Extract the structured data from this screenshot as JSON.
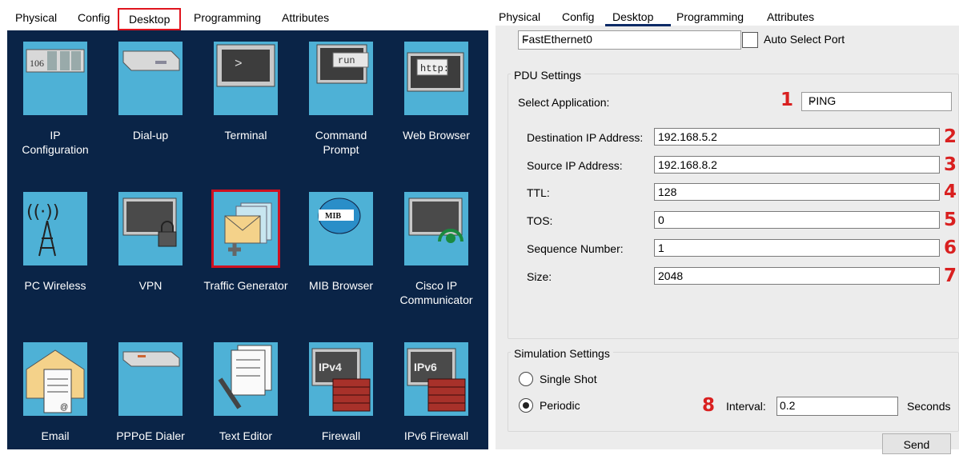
{
  "left": {
    "tabs": [
      "Physical",
      "Config",
      "Desktop",
      "Programming",
      "Attributes"
    ],
    "apps": [
      {
        "label": "IP Configuration",
        "icon": "ip-configuration-icon"
      },
      {
        "label": "Dial-up",
        "icon": "dial-up-icon"
      },
      {
        "label": "Terminal",
        "icon": "terminal-icon",
        "glyph": ">"
      },
      {
        "label": "Command Prompt",
        "icon": "command-prompt-icon",
        "glyph": "run"
      },
      {
        "label": "Web Browser",
        "icon": "web-browser-icon",
        "glyph": "http:"
      },
      {
        "label": "PC Wireless",
        "icon": "pc-wireless-icon"
      },
      {
        "label": "VPN",
        "icon": "vpn-icon"
      },
      {
        "label": "Traffic Generator",
        "icon": "traffic-generator-icon"
      },
      {
        "label": "MIB Browser",
        "icon": "mib-browser-icon",
        "glyph": "MIB"
      },
      {
        "label": "Cisco IP Communicator",
        "icon": "cisco-ip-communicator-icon"
      },
      {
        "label": "Email",
        "icon": "email-icon",
        "glyph": "@"
      },
      {
        "label": "PPPoE Dialer",
        "icon": "pppoe-dialer-icon"
      },
      {
        "label": "Text Editor",
        "icon": "text-editor-icon"
      },
      {
        "label": "Firewall",
        "icon": "firewall-icon",
        "glyph": "IPv4"
      },
      {
        "label": "IPv6 Firewall",
        "icon": "ipv6-firewall-icon",
        "glyph": "IPv6"
      }
    ],
    "ip_config_glyph": "106"
  },
  "right": {
    "tabs": [
      "Physical",
      "Config",
      "Desktop",
      "Programming",
      "Attributes"
    ],
    "port": "FastEthernet0",
    "auto_select_port": "Auto Select Port",
    "pdu_settings": "PDU Settings",
    "select_application_label": "Select Application:",
    "select_application_value": "PING",
    "fields": [
      {
        "label": "Destination IP Address:",
        "value": "192.168.5.2",
        "num": "2"
      },
      {
        "label": "Source IP Address:",
        "value": "192.168.8.2",
        "num": "3"
      },
      {
        "label": "TTL:",
        "value": "128",
        "num": "4"
      },
      {
        "label": "TOS:",
        "value": "0",
        "num": "5"
      },
      {
        "label": "Sequence Number:",
        "value": "1",
        "num": "6"
      },
      {
        "label": "Size:",
        "value": "2048",
        "num": "7"
      }
    ],
    "num_app": "1",
    "simulation_settings": "Simulation Settings",
    "single_shot": "Single Shot",
    "periodic": "Periodic",
    "num_interval": "8",
    "interval_label": "Interval:",
    "interval_value": "0.2",
    "seconds": "Seconds",
    "send": "Send",
    "colors": {
      "annotation": "#d92020",
      "tile": "#4eb1d6",
      "desktop_bg": "#0a2447",
      "highlight": "#d01020"
    }
  }
}
